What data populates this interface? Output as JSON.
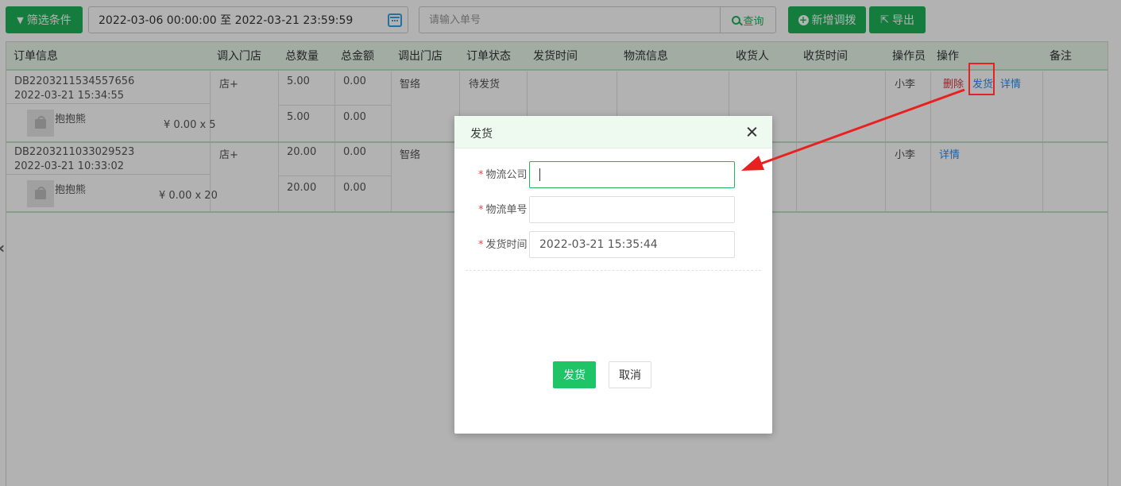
{
  "toolbar": {
    "filter_label": "筛选条件",
    "date_range": "2022-03-06 00:00:00 至 2022-03-21 23:59:59",
    "search_placeholder": "请输入单号",
    "query_label": "查询",
    "add_label": "新增调拨",
    "export_label": "导出"
  },
  "table": {
    "headers": [
      "订单信息",
      "调入门店",
      "总数量",
      "总金额",
      "调出门店",
      "订单状态",
      "发货时间",
      "物流信息",
      "收货人",
      "收货时间",
      "操作员",
      "操作",
      "备注"
    ],
    "orders": [
      {
        "order_no": "DB2203211534557656",
        "order_time": "2022-03-21 15:34:55",
        "in_store": "店+",
        "total_qty": "5.00",
        "total_amount": "0.00",
        "out_store": "智络",
        "status": "待发货",
        "operator": "小李",
        "actions": [
          "删除",
          "发货",
          "详情"
        ],
        "item": {
          "name": "抱抱熊",
          "price_qty": "¥ 0.00 x 5",
          "qty": "5.00",
          "amount": "0.00"
        }
      },
      {
        "order_no": "DB2203211033029523",
        "order_time": "2022-03-21 10:33:02",
        "in_store": "店+",
        "total_qty": "20.00",
        "total_amount": "0.00",
        "out_store": "智络",
        "status": "",
        "operator": "小李",
        "actions": [
          "详情"
        ],
        "item": {
          "name": "抱抱熊",
          "price_qty": "¥ 0.00 x 20",
          "qty": "20.00",
          "amount": "0.00"
        }
      }
    ]
  },
  "modal": {
    "title": "发货",
    "fields": [
      {
        "label": "物流公司",
        "value": "",
        "required": true
      },
      {
        "label": "物流单号",
        "value": "",
        "required": true
      },
      {
        "label": "发货时间",
        "value": "2022-03-21 15:35:44",
        "required": true
      }
    ],
    "submit_label": "发货",
    "cancel_label": "取消"
  },
  "colors": {
    "primary_green": "#1eb35a",
    "header_bg": "#e8f6ea",
    "delete_red": "#d9363e",
    "link_blue": "#2d8cf0",
    "annotation_red": "#e82020"
  }
}
